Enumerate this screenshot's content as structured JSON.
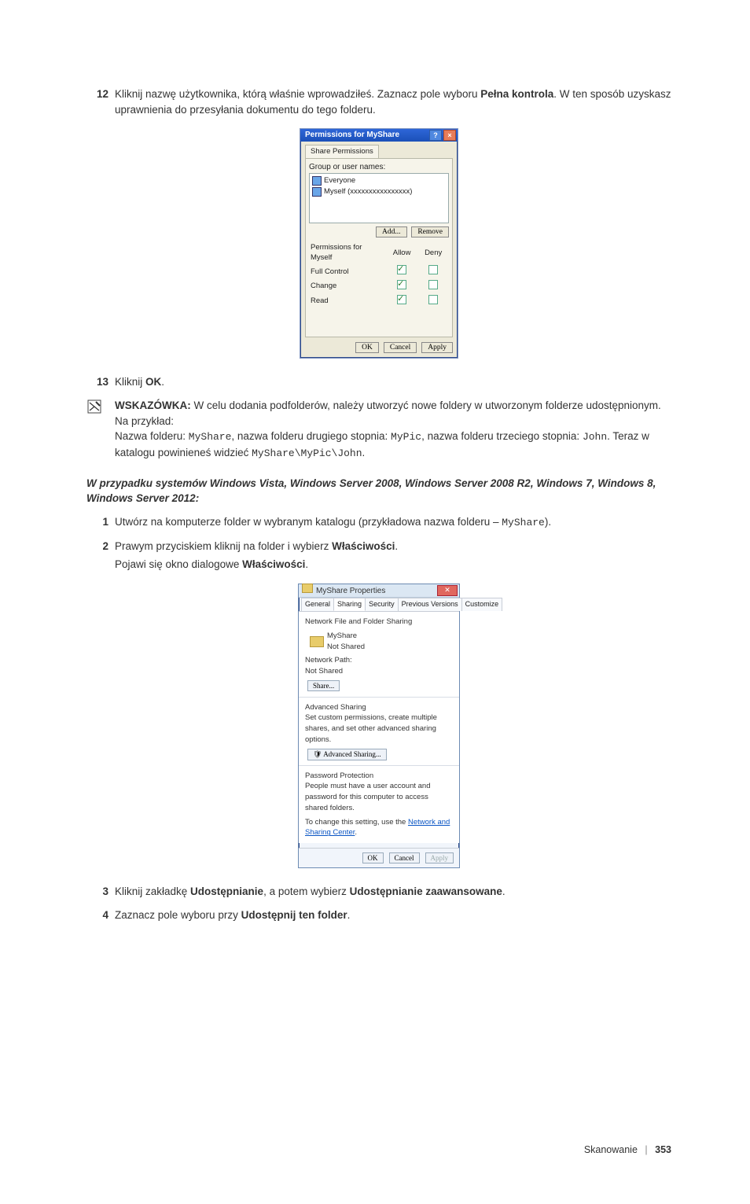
{
  "steps": {
    "s12": {
      "num": "12",
      "text_a": "Kliknij nazwę użytkownika, którą właśnie wprowadziłeś. Zaznacz pole wyboru ",
      "bold": "Pełna kontrola",
      "text_b": ". W ten sposób uzyskasz uprawnienia do przesyłania dokumentu do tego folderu."
    },
    "s13": {
      "num": "13",
      "text_a": "Kliknij ",
      "bold": "OK",
      "text_b": "."
    },
    "s1": {
      "num": "1",
      "text_a": "Utwórz na komputerze folder w wybranym katalogu (przykładowa nazwa folderu – ",
      "mono": "MyShare",
      "text_b": ")."
    },
    "s2": {
      "num": "2",
      "text_a": "Prawym przyciskiem kliknij na folder i wybierz ",
      "bold": "Właściwości",
      "text_b": ".",
      "body2_a": "Pojawi się okno dialogowe ",
      "body2_bold": "Właściwości",
      "body2_b": "."
    },
    "s3": {
      "num": "3",
      "text_a": "Kliknij zakładkę ",
      "bold1": "Udostępnianie",
      "mid": ", a potem wybierz ",
      "bold2": "Udostępnianie zaawansowane",
      "text_b": "."
    },
    "s4": {
      "num": "4",
      "text_a": "Zaznacz pole wyboru przy ",
      "bold": "Udostępnij ten folder",
      "text_b": "."
    }
  },
  "note": {
    "label": "WSKAZÓWKA:",
    "text_a": " W celu dodania podfolderów, należy utworzyć nowe foldery w utworzonym folderze udostępnionym.",
    "line2": "Na przykład:",
    "line3_a": "Nazwa folderu: ",
    "mono1": "MyShare",
    "line3_b": ", nazwa folderu drugiego stopnia: ",
    "mono2": "MyPic",
    "line3_c": ", nazwa folderu trzeciego stopnia: ",
    "mono3": "John",
    "line3_d": ". Teraz w katalogu powinieneś widzieć ",
    "mono4": "MyShare\\MyPic\\John",
    "line3_e": "."
  },
  "dlg1": {
    "title": "Permissions for MyShare",
    "tab": "Share Permissions",
    "group_label": "Group or user names:",
    "everyone": "Everyone",
    "myself": "Myself (xxxxxxxxxxxxxxxx)",
    "add_btn": "Add...",
    "remove_btn": "Remove",
    "perm_for": "Permissions for Myself",
    "allow": "Allow",
    "deny": "Deny",
    "p_full": "Full Control",
    "p_change": "Change",
    "p_read": "Read",
    "ok": "OK",
    "cancel": "Cancel",
    "apply": "Apply"
  },
  "heading": "W przypadku systemów Windows Vista, Windows Server 2008, Windows Server 2008 R2, Windows 7, Windows 8, Windows Server 2012:",
  "dlg2": {
    "title": "MyShare Properties",
    "tabs": {
      "general": "General",
      "sharing": "Sharing",
      "security": "Security",
      "prev": "Previous Versions",
      "custom": "Customize"
    },
    "sect1": "Network File and Folder Sharing",
    "folder_name": "MyShare",
    "not_shared": "Not Shared",
    "net_path_lbl": "Network Path:",
    "net_path_val": "Not Shared",
    "share_btn": "Share...",
    "sect2": "Advanced Sharing",
    "sect2_text": "Set custom permissions, create multiple shares, and set other advanced sharing options.",
    "adv_btn": "Advanced Sharing...",
    "sect3": "Password Protection",
    "sect3_text": "People must have a user account and password for this computer to access shared folders.",
    "sect3_text2a": "To change this setting, use the ",
    "sect3_link": "Network and Sharing Center",
    "sect3_text2b": ".",
    "ok": "OK",
    "cancel": "Cancel",
    "apply": "Apply"
  },
  "footer": {
    "section": "Skanowanie",
    "page": "353"
  }
}
